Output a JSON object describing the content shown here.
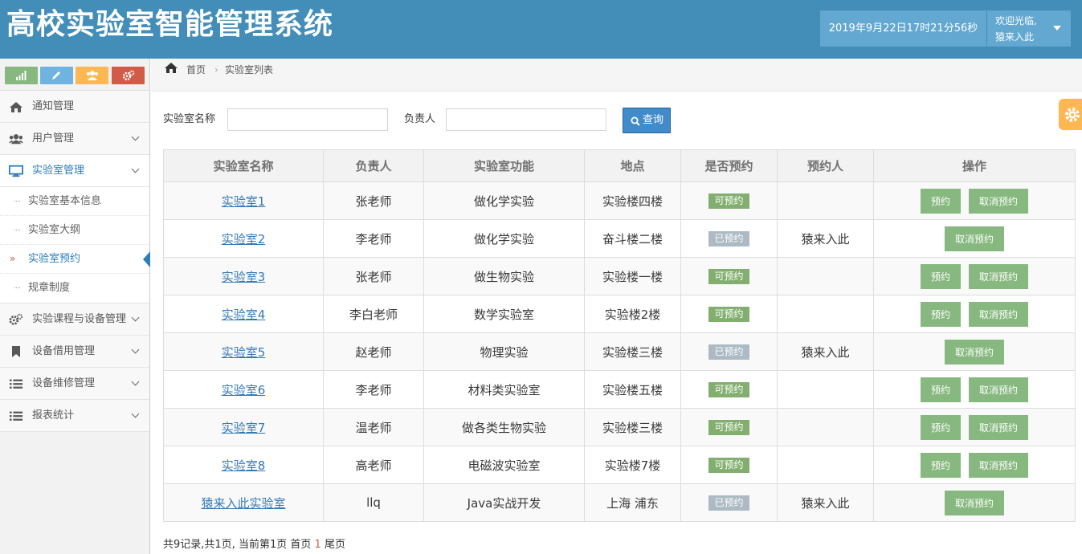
{
  "app": {
    "title": "高校实验室智能管理系统"
  },
  "header": {
    "clock": "2019年9月22日17时21分56秒",
    "welcome": "欢迎光临,",
    "username": "猿来入此"
  },
  "colors": {
    "header": "#438eb9",
    "accent": "#2b7dbc",
    "success": "#82af6f",
    "button": "#87b87f",
    "booked": "#abbac3",
    "settings": "#ffb752"
  },
  "shortcuts": [
    {
      "icon": "signal-icon",
      "color": "#87b87f"
    },
    {
      "icon": "pencil-icon",
      "color": "#6fb3e0"
    },
    {
      "icon": "users-icon",
      "color": "#ffb752"
    },
    {
      "icon": "cogs-icon",
      "color": "#d15b47"
    }
  ],
  "sidebar": {
    "items": [
      {
        "label": "通知管理",
        "icon": "home-icon"
      },
      {
        "label": "用户管理",
        "icon": "users-icon"
      },
      {
        "label": "实验室管理",
        "icon": "desktop-icon"
      },
      {
        "label": "实验课程与设备管理",
        "icon": "cogs-icon"
      },
      {
        "label": "设备借用管理",
        "icon": "bookmark-icon"
      },
      {
        "label": "设备维修管理",
        "icon": "list-icon"
      },
      {
        "label": "报表统计",
        "icon": "list-icon"
      }
    ],
    "submenu": [
      {
        "label": "实验室基本信息"
      },
      {
        "label": "实验室大纲"
      },
      {
        "label": "实验室预约"
      },
      {
        "label": "规章制度"
      }
    ]
  },
  "breadcrumb": {
    "home": "首页",
    "current": "实验室列表"
  },
  "search": {
    "name_label": "实验室名称",
    "owner_label": "负责人",
    "button": "查询"
  },
  "table": {
    "headers": [
      "实验室名称",
      "负责人",
      "实验室功能",
      "地点",
      "是否预约",
      "预约人",
      "操作"
    ],
    "rows": [
      {
        "name": "实验室1",
        "owner": "张老师",
        "func": "做化学实验",
        "place": "实验楼四楼",
        "status": "可预约",
        "booker": ""
      },
      {
        "name": "实验室2",
        "owner": "李老师",
        "func": "做化学实验",
        "place": "奋斗楼二楼",
        "status": "已预约",
        "booker": "猿来入此"
      },
      {
        "name": "实验室3",
        "owner": "张老师",
        "func": "做生物实验",
        "place": "实验楼一楼",
        "status": "可预约",
        "booker": ""
      },
      {
        "name": "实验室4",
        "owner": "李白老师",
        "func": "数学实验室",
        "place": "实验楼2楼",
        "status": "可预约",
        "booker": ""
      },
      {
        "name": "实验室5",
        "owner": "赵老师",
        "func": "物理实验",
        "place": "实验楼三楼",
        "status": "已预约",
        "booker": "猿来入此"
      },
      {
        "name": "实验室6",
        "owner": "李老师",
        "func": "材料类实验室",
        "place": "实验楼五楼",
        "status": "可预约",
        "booker": ""
      },
      {
        "name": "实验室7",
        "owner": "温老师",
        "func": "做各类生物实验",
        "place": "实验楼三楼",
        "status": "可预约",
        "booker": ""
      },
      {
        "name": "实验室8",
        "owner": "高老师",
        "func": "电磁波实验室",
        "place": "实验楼7楼",
        "status": "可预约",
        "booker": ""
      },
      {
        "name": "猿来入此实验室",
        "owner": "llq",
        "func": "Java实战开发",
        "place": "上海 浦东",
        "status": "已预约",
        "booker": "猿来入此"
      }
    ],
    "book_label": "预约",
    "cancel_label": "取消预约"
  },
  "pager": {
    "summary": "共9记录,共1页, 当前第1页",
    "first": "首页",
    "current": "1",
    "last": "尾页"
  }
}
